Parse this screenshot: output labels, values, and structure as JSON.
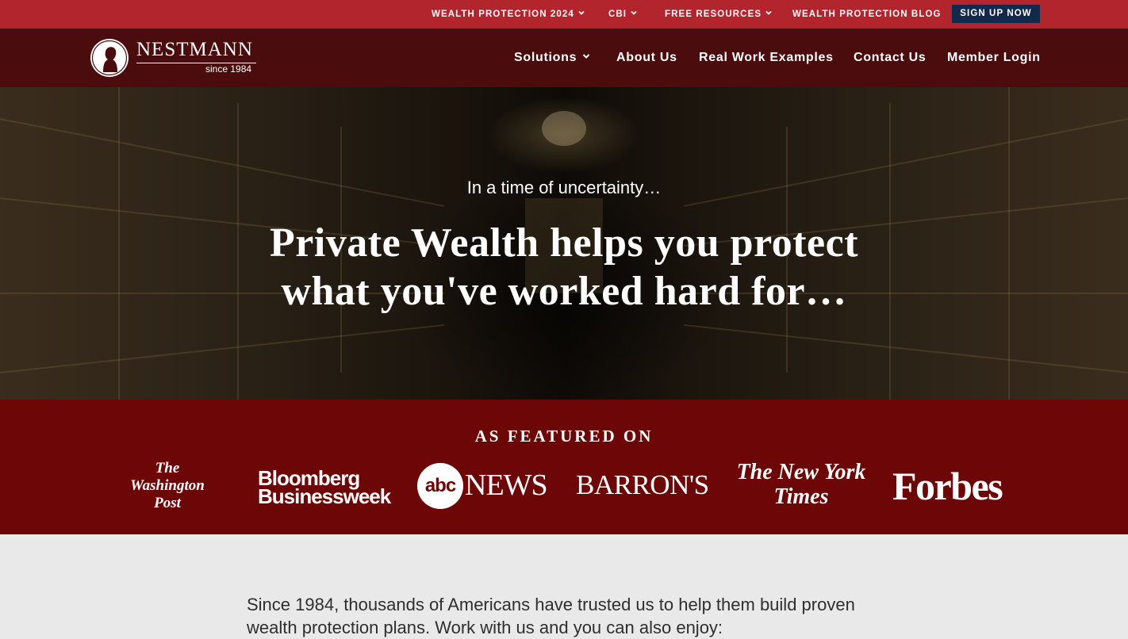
{
  "topbar": {
    "items": [
      {
        "label": "WEALTH PROTECTION 2024",
        "has_dropdown": true
      },
      {
        "label": "CBI",
        "has_dropdown": true
      },
      {
        "label": "FREE RESOURCES",
        "has_dropdown": true
      },
      {
        "label": "WEALTH PROTECTION BLOG",
        "has_dropdown": false
      }
    ],
    "signup_label": "SIGN UP NOW"
  },
  "logo": {
    "wordmark": "NESTMANN",
    "since": "since 1984"
  },
  "nav": {
    "items": [
      {
        "label": "Solutions",
        "has_dropdown": true
      },
      {
        "label": "About Us",
        "has_dropdown": false
      },
      {
        "label": "Real Work Examples",
        "has_dropdown": false
      },
      {
        "label": "Contact Us",
        "has_dropdown": false
      },
      {
        "label": "Member Login",
        "has_dropdown": false
      }
    ]
  },
  "hero": {
    "subheadline": "In a time of uncertainty…",
    "headline_line1": "Private Wealth helps you protect",
    "headline_line2": "what you've worked hard for…"
  },
  "featured": {
    "title": "AS FEATURED ON",
    "publications": {
      "wapo": {
        "line1": "The",
        "line2": "Washington",
        "line3": "Post"
      },
      "bloomberg": {
        "line1": "Bloomberg",
        "line2": "Businessweek"
      },
      "abc": {
        "circle": "abc",
        "word": "NEWS"
      },
      "barrons": "BARRON'S",
      "nyt": {
        "line1": "The New York",
        "line2": "Times"
      },
      "forbes": "Forbes"
    }
  },
  "intro": {
    "text": "Since 1984, thousands of Americans have trusted us to help them build proven wealth protection plans. Work with us and you can also enjoy:"
  },
  "colors": {
    "topbar": "#b3252c",
    "nav": "#4a0c0c",
    "featured": "#6d0707",
    "signup": "#13294b"
  }
}
